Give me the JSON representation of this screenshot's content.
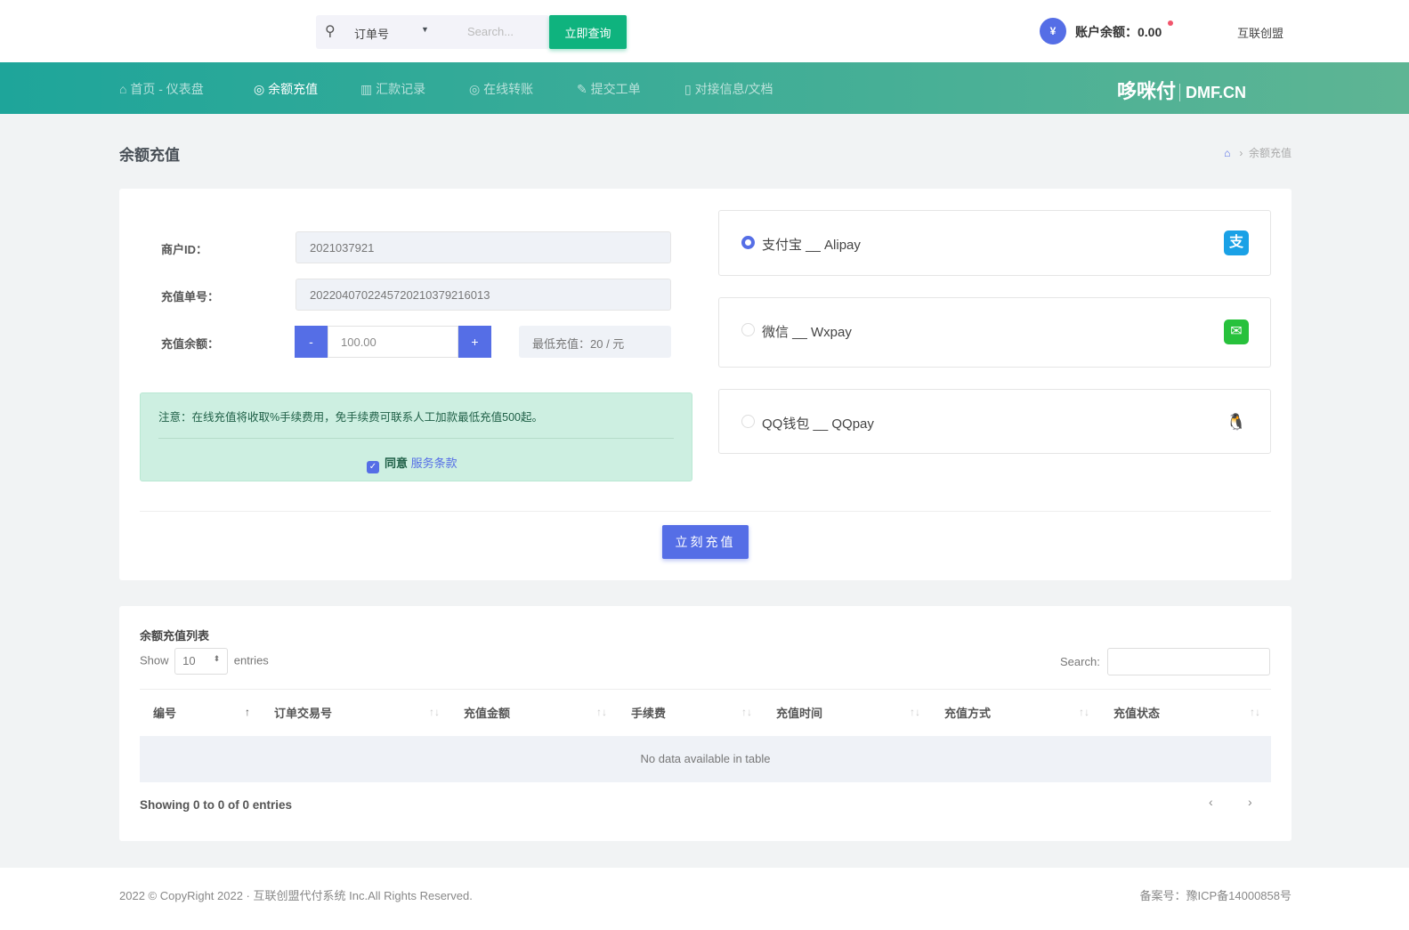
{
  "topbar": {
    "search_type": "订单号",
    "search_placeholder": "Search...",
    "query_button": "立即查询",
    "balance": "账户余额：0.00",
    "yen": "¥",
    "user": "互联创盟"
  },
  "nav": {
    "items": [
      {
        "label": "首页 - 仪表盘",
        "icon": "⌂"
      },
      {
        "label": "余额充值",
        "icon": "◎"
      },
      {
        "label": "汇款记录",
        "icon": "▥"
      },
      {
        "label": "在线转账",
        "icon": "◎"
      },
      {
        "label": "提交工单",
        "icon": "✎"
      },
      {
        "label": "对接信息/文档",
        "icon": "▯"
      }
    ],
    "logo": "哆咪付",
    "logo_domain": "DMF.CN"
  },
  "page": {
    "title": "余额充值",
    "breadcrumb": "余额充值"
  },
  "form": {
    "merchant_label": "商户ID：",
    "merchant_id": "2021037921",
    "order_label": "充值单号：",
    "order_no": "2022040702245720210379216013",
    "amount_label": "充值余额：",
    "minus": "-",
    "plus": "+",
    "amount": "100.00",
    "min_charge": "最低充值：20 / 元",
    "notice": "注意：在线充值将收取%手续费用，免手续费可联系人工加款最低充值500起。",
    "agree": "同意",
    "terms": "服务条款",
    "submit": "立刻充值"
  },
  "payments": [
    {
      "label": "支付宝 __ Alipay",
      "icon": "支",
      "color": "#1aa1e6",
      "selected": true
    },
    {
      "label": "微信 __ Wxpay",
      "icon": "✉",
      "color": "#27c13c",
      "selected": false
    },
    {
      "label": "QQ钱包 __ QQpay",
      "icon": "🐧",
      "color": "#ffffff",
      "selected": false
    }
  ],
  "list": {
    "title": "余额充值列表",
    "show": "Show",
    "length": "10",
    "entries": "entries",
    "search": "Search:",
    "columns": [
      "编号",
      "订单交易号",
      "充值金额",
      "手续费",
      "充值时间",
      "充值方式",
      "充值状态"
    ],
    "empty": "No data available in table",
    "info": "Showing 0 to 0 of 0 entries",
    "prev": "‹",
    "next": "›"
  },
  "footer": {
    "copyright": "2022 © CopyRight 2022 · 互联创盟代付系统 Inc.All Rights Reserved.",
    "icp": "备案号：豫ICP备14000858号"
  }
}
